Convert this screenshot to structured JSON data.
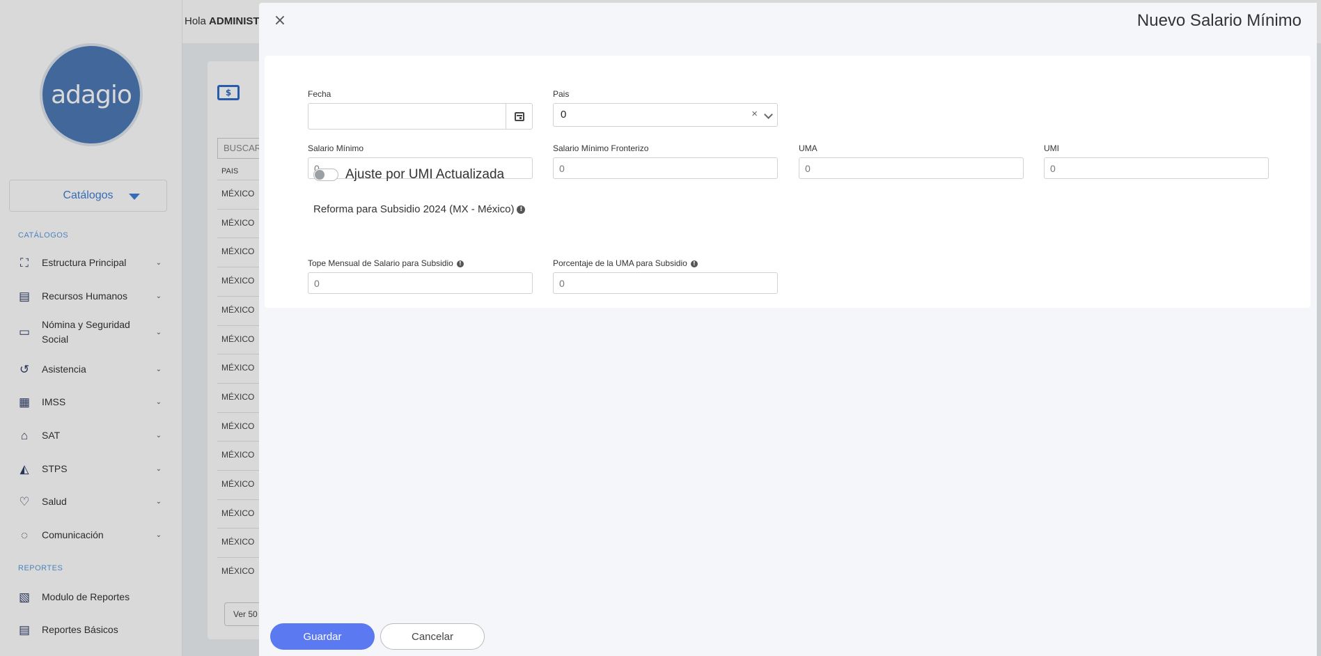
{
  "sidebar": {
    "logo_text": "adagio",
    "catalog_select": "Catálogos",
    "sections": {
      "catalogos": "CATÁLOGOS",
      "reportes": "REPORTES"
    },
    "items": [
      {
        "label": "Estructura Principal",
        "icon": "org-chart-icon",
        "glyph": "⛶"
      },
      {
        "label": "Recursos Humanos",
        "icon": "id-card-icon",
        "glyph": "▤"
      },
      {
        "label": "Nómina y Seguridad Social",
        "icon": "money-icon",
        "glyph": "▭"
      },
      {
        "label": "Asistencia",
        "icon": "history-icon",
        "glyph": "↺"
      },
      {
        "label": "IMSS",
        "icon": "building-icon",
        "glyph": "▦"
      },
      {
        "label": "SAT",
        "icon": "bank-icon",
        "glyph": "⌂"
      },
      {
        "label": "STPS",
        "icon": "graduation-cap-icon",
        "glyph": "◭"
      },
      {
        "label": "Salud",
        "icon": "stethoscope-icon",
        "glyph": "♡"
      },
      {
        "label": "Comunicación",
        "icon": "chat-icon",
        "glyph": "◌"
      }
    ],
    "report_items": [
      {
        "label": "Modulo de Reportes",
        "icon": "excel-file-icon",
        "glyph": "▧"
      },
      {
        "label": "Reportes Básicos",
        "icon": "document-icon",
        "glyph": "▤"
      }
    ]
  },
  "header": {
    "greeting": "Hola",
    "user": "ADMINIST"
  },
  "background": {
    "search_placeholder": "BUSCAR",
    "column_header": "PAIS",
    "row_value": "MÉXICO",
    "rows": 14,
    "page_size_label": "Ver 50"
  },
  "modal": {
    "title": "Nuevo Salario Mínimo",
    "close": "×",
    "fields": {
      "fecha": {
        "label": "Fecha",
        "value": ""
      },
      "pais": {
        "label": "Pais",
        "value": "0"
      },
      "salario_minimo": {
        "label": "Salario Mínimo",
        "placeholder": "0"
      },
      "salario_fronterizo": {
        "label": "Salario Mínimo Fronterizo",
        "placeholder": "0"
      },
      "uma": {
        "label": "UMA",
        "placeholder": "0"
      },
      "umi": {
        "label": "UMI",
        "placeholder": "0"
      },
      "tope_mensual": {
        "label": "Tope Mensual de Salario para Subsidio",
        "placeholder": "0"
      },
      "porcentaje_uma": {
        "label": "Porcentaje de la UMA para Subsidio",
        "placeholder": "0"
      }
    },
    "toggle_label": "Ajuste por UMI Actualizada",
    "reforma_title": "Reforma para Subsidio 2024 (MX - México)",
    "buttons": {
      "save": "Guardar",
      "cancel": "Cancelar"
    }
  },
  "colors": {
    "primary": "#5b79f0",
    "logo": "#4e79b7",
    "accent": "#3f7fd6"
  }
}
